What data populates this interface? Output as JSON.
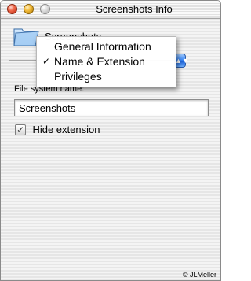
{
  "window": {
    "title": "Screenshots Info"
  },
  "header": {
    "name": "Screenshots",
    "icon": "folder-icon"
  },
  "info_menu": {
    "items": [
      {
        "label": "General Information",
        "checked": false
      },
      {
        "label": "Name & Extension",
        "checked": true
      },
      {
        "label": "Privileges",
        "checked": false
      }
    ],
    "check_glyph": "✓",
    "popup_arrow": "▲▼"
  },
  "name_section": {
    "label": "File system name:",
    "value": "Screenshots"
  },
  "hide_extension": {
    "label": "Hide extension",
    "checked": true,
    "glyph": "✓"
  },
  "credit": {
    "text": "© JLMeller"
  },
  "colors": {
    "accent": "#3d8af7",
    "close": "#f06a4c",
    "minimize": "#f4bd3d"
  }
}
